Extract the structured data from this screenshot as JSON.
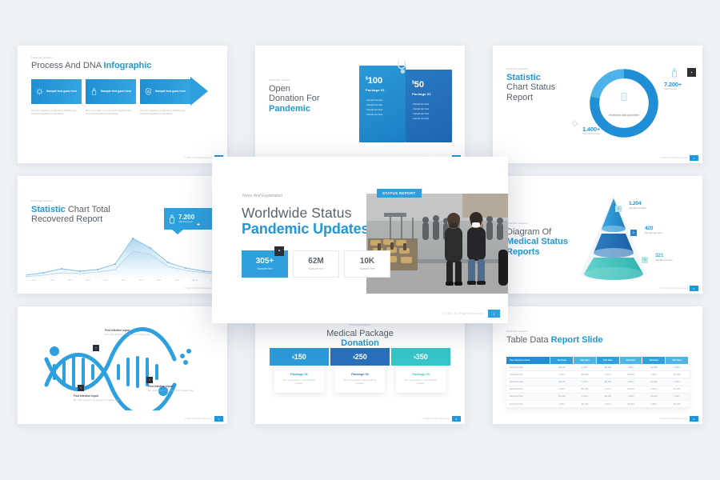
{
  "background_color": "#eef1f5",
  "accent_color": "#1f97d8",
  "footer": {
    "copyright": "© 2022 All Rights Reserved",
    "page": "1"
  },
  "slides": [
    {
      "id": "process-and-dna",
      "eyebrow": "Protection measure",
      "title_plain": "Process And DNA ",
      "title_accent": "Infographic",
      "steps": [
        {
          "icon": "virus-icon",
          "label": "Sample text goes here",
          "caption": "But I must explain to you how all this mistaken idea of denouncing pleasure and praising."
        },
        {
          "icon": "sanitizer-icon",
          "label": "Sample text goes here",
          "caption": "But I must explain to you how all this mistaken idea of denouncing pleasure and praising."
        },
        {
          "icon": "shield-icon",
          "label": "Sample text goes here",
          "caption": "But I must explain to you how all this mistaken idea of denouncing pleasure and praising."
        }
      ],
      "page": "2"
    },
    {
      "id": "open-donation",
      "eyebrow": "Protection measure",
      "title_line1": "Open",
      "title_line2": "Donation For",
      "title_accent": "Pandemic",
      "packages": [
        {
          "currency": "$",
          "amount": "100",
          "name": "Package 01",
          "items": [
            "Sample text here",
            "Sample text here",
            "Sample text here",
            "Sample text here"
          ]
        },
        {
          "currency": "$",
          "amount": "50",
          "name": "Package 02",
          "items": [
            "Sample text here",
            "Sample text here",
            "Sample text here",
            "Sample text here"
          ]
        }
      ],
      "page": "3"
    },
    {
      "id": "statistic-chart-status",
      "eyebrow": "Protection measure",
      "title_accent": "Statistic",
      "title_line2": "Chart Status",
      "title_line3": "Report",
      "donut_center": "Worldwide data parameter",
      "stat_right": {
        "value": "7.200+",
        "caption": "Total recovered"
      },
      "stat_left": {
        "value": "1.400+",
        "caption": "Total confirmed case"
      },
      "page": "4"
    },
    {
      "id": "statistic-chart-total-recovered",
      "eyebrow": "Protection measure",
      "title_accent": "Statistic",
      "title_rest": " Chart Total",
      "title_line2": "Recovered Report",
      "callout": {
        "value": "7.200",
        "suffix": "+",
        "caption": "Total Recovered",
        "icon": "sanitizer-icon"
      },
      "page": "5"
    },
    {
      "id": "worldwide-status-featured",
      "eyebrow": "News And Explanation",
      "title_line1": "Worldwide Status",
      "title_accent": "Pandemic Updates",
      "badge": "STATUS REPORT",
      "stats": [
        {
          "value": "305+",
          "label": "Sample text",
          "active": true
        },
        {
          "value": "62M",
          "label": "Sample text",
          "active": false
        },
        {
          "value": "10K",
          "label": "Sample text",
          "active": false
        }
      ],
      "page": "1"
    },
    {
      "id": "diagram-medical-status",
      "eyebrow": "Protection measure",
      "title_line1": "Diagram Of",
      "title_accent1": "Medical Status",
      "title_accent2": "Reports",
      "levels": [
        {
          "chip": "1",
          "value": "1.204",
          "caption": "Sample text here"
        },
        {
          "chip": "2",
          "value": "420",
          "caption": "Sample text here"
        },
        {
          "chip": "3",
          "value": "321",
          "caption": "Sample text here"
        }
      ],
      "page": "6"
    },
    {
      "id": "dna-infection-report",
      "notes": [
        {
          "title": "First infection report",
          "body": "But I must explain to you how all this mistaken idea."
        },
        {
          "title": "First infection report",
          "body": "But I must explain to you how all this mistaken idea."
        },
        {
          "title": "First infection report",
          "body": "But I must explain to you how all this mistaken idea."
        }
      ],
      "page": "7"
    },
    {
      "id": "medical-package-donation",
      "eyebrow": "Protection measure",
      "title_line1": "Medical Package",
      "title_accent": "Donation",
      "packages": [
        {
          "currency": "$",
          "amount": "150",
          "name": "Package 01",
          "color": "#2c9ad9",
          "desc": "But I must explain to you how all this mistaken."
        },
        {
          "currency": "$",
          "amount": "250",
          "name": "Package 02",
          "color": "#2a6fba",
          "desc": "But I must explain to you how all this mistaken."
        },
        {
          "currency": "$",
          "amount": "350",
          "name": "Package 03",
          "color": "#36c4c8",
          "desc": "But I must explain to you how all this mistaken."
        }
      ],
      "page": "8"
    },
    {
      "id": "table-data-report",
      "eyebrow": "Protection measure",
      "title_plain": "Table Data ",
      "title_accent": "Report Slide",
      "table": {
        "headers": [
          "Your Text Goes Here",
          "Text Here",
          "Text Here",
          "Text Here",
          "Text Here",
          "Text Here",
          "Text Here"
        ],
        "rows": [
          [
            "Insert Text Here",
            "$11,283",
            "1,283.2",
            "$11,283",
            "1,283.2",
            "$11,283",
            "1,283.2"
          ],
          [
            "Insert Text Here",
            "1,283.2",
            "$11,283",
            "1,283.2",
            "$11,283",
            "1,283.2",
            "$11,283"
          ],
          [
            "Insert Text Here",
            "$11,283",
            "1,283.2",
            "$11,283",
            "1,283.2",
            "$11,283",
            "1,283.2"
          ],
          [
            "Insert Text Here",
            "1,283.2",
            "$11,283",
            "1,283.2",
            "$11,283",
            "1,283.2",
            "$11,283"
          ],
          [
            "Insert Text Here",
            "$11,283",
            "1,283.2",
            "$11,283",
            "1,283.2",
            "$11,283",
            "1,283.2"
          ],
          [
            "Insert Text Here",
            "1,283.2",
            "$11,283",
            "1,283.2",
            "$11,283",
            "1,283.2",
            "$11,283"
          ]
        ]
      },
      "page": "9"
    }
  ],
  "chart_data": {
    "type": "area",
    "title": "Statistic Chart Total Recovered Report",
    "xlabel": "",
    "ylabel": "",
    "grid": false,
    "legend": "none",
    "categories": [
      "Jan 1",
      "Jan 2",
      "Jan 3",
      "Jan 4",
      "Jan 5",
      "Jan 6",
      "Jan 7",
      "Jan 8",
      "Jan 9",
      "Jan 10",
      "Jan 11"
    ],
    "series": [
      {
        "name": "Recovered",
        "values": [
          4,
          7,
          12,
          9,
          11,
          18,
          52,
          40,
          22,
          15,
          10
        ]
      },
      {
        "name": "Confirmed",
        "values": [
          2,
          4,
          7,
          6,
          8,
          13,
          34,
          30,
          17,
          11,
          7
        ]
      }
    ],
    "ylim": [
      0,
      56
    ]
  },
  "donut_chart": {
    "type": "pie",
    "title": "Worldwide data parameter",
    "labels": [
      "Total confirmed case",
      "Total recovered"
    ],
    "values": [
      78,
      22
    ],
    "colors": [
      "#1f8ed4",
      "#4db2e8"
    ]
  }
}
